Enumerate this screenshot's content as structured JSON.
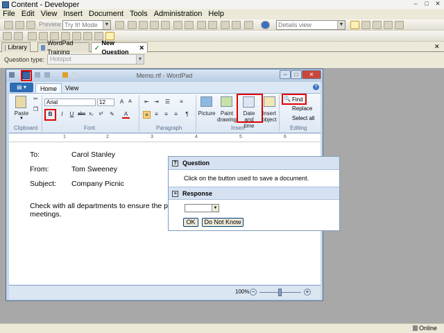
{
  "app": {
    "title": "Content - Developer"
  },
  "menu": [
    "File",
    "Edit",
    "View",
    "Insert",
    "Document",
    "Tools",
    "Administration",
    "Help"
  ],
  "toolbar": {
    "preview_label": "Preview",
    "try_mode": "Try It! Mode",
    "view_select": "Details view"
  },
  "tabs": [
    {
      "label": "Library",
      "active": false
    },
    {
      "label": "WordPad Training",
      "active": false
    },
    {
      "label": "New Question",
      "active": true
    }
  ],
  "question_type": {
    "label": "Question type:",
    "value": "Hotspot"
  },
  "wordpad": {
    "title": "Memo.rtf - WordPad",
    "ribbon_tabs": [
      "Home",
      "View"
    ],
    "clipboard": {
      "paste": "Paste",
      "group": "Clipboard"
    },
    "font": {
      "name": "Arial",
      "size": "12",
      "group": "Font"
    },
    "paragraph_group": "Paragraph",
    "insert": {
      "picture": "Picture",
      "paint": "Paint drawing",
      "paint1": "Paint",
      "paint2": "drawing",
      "date1": "Date and",
      "date2": "time",
      "object1": "Insert",
      "object2": "object",
      "group": "Insert"
    },
    "editing": {
      "find": "Find",
      "replace": "Replace",
      "select_all": "Select all",
      "group": "Editing"
    },
    "ruler": [
      "1",
      "2",
      "3",
      "4",
      "5",
      "6"
    ],
    "document": {
      "to_label": "To:",
      "to_value": "Carol Stanley",
      "from_label": "From:",
      "from_value": "Tom Sweeney",
      "subject_label": "Subject:",
      "subject_value": "Company Picnic",
      "body1": "Check with all departments to ensure the plann",
      "body2": "meetings."
    },
    "zoom": "100%"
  },
  "question_panel": {
    "question_header": "Question",
    "question_text": "Click on the button used to save a document.",
    "response_header": "Response",
    "ok_label": "OK",
    "dont_know_label": "Do Not Know"
  },
  "status": {
    "online": "Online"
  },
  "colors": {
    "highlight_box": "#e00000",
    "ribbon_blue": "#2f6db5"
  }
}
